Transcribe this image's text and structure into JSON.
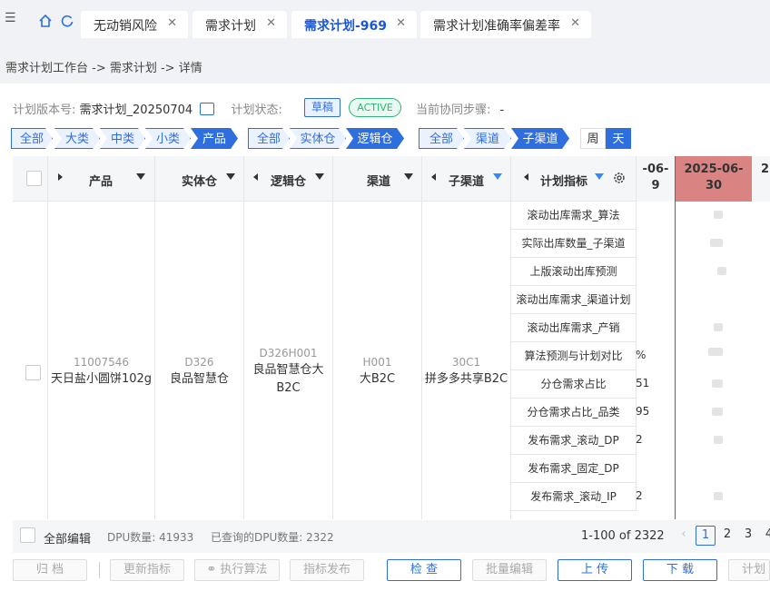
{
  "tabs": [
    {
      "label": "无动销风险"
    },
    {
      "label": "需求计划"
    },
    {
      "label": "需求计划-969"
    },
    {
      "label": "需求计划准确率偏差率"
    }
  ],
  "breadcrumb": "需求计划工作台 -> 需求计划 -> 详情",
  "plan_info": {
    "version_label": "计划版本号:",
    "version_value": "需求计划_20250704",
    "status_label": "计划状态:",
    "status_draft": "草稿",
    "status_active": "ACTIVE",
    "step_label": "当前协同步骤:",
    "step_value": "-"
  },
  "product_levels": [
    "全部",
    "大类",
    "中类",
    "小类",
    "产品"
  ],
  "warehouse_levels": [
    "全部",
    "实体仓",
    "逻辑仓"
  ],
  "channel_levels": [
    "全部",
    "渠道",
    "子渠道"
  ],
  "time_grain": [
    "周",
    "天"
  ],
  "columns": {
    "product": "产品",
    "physical_wh": "实体仓",
    "logical_wh": "逻辑仓",
    "channel": "渠道",
    "sub_channel": "子渠道",
    "metric": "计划指标"
  },
  "dates": {
    "prev_partial_top": "-06-",
    "prev_partial_bottom": "9",
    "current_top": "2025-06-",
    "current_bottom": "30",
    "next_partial": "2"
  },
  "row": {
    "product_code": "11007546",
    "product_name": "天日盐小圆饼102g",
    "physical_code": "D326",
    "physical_name": "良品智慧仓",
    "logical_code": "D326H001",
    "logical_name_1": "良品智慧仓大",
    "logical_name_2": "B2C",
    "channel_code": "H001",
    "channel_name": "大B2C",
    "sub_code": "30C1",
    "sub_name": "拼多多共享B2C"
  },
  "metrics": [
    "滚动出库需求_算法",
    "实际出库数量_子渠道",
    "上版滚动出库预测",
    "滚动出库需求_渠道计划",
    "滚动出库需求_产销",
    "算法预测与计划对比",
    "分仓需求占比",
    "分仓需求占比_品类",
    "发布需求_滚动_DP",
    "发布需求_固定_DP",
    "发布需求_滚动_IP"
  ],
  "truncated_values": [
    "%",
    "51",
    "95",
    "2",
    "2"
  ],
  "footer": {
    "edit_all": "全部编辑",
    "dpu_count": "DPU数量: 41933",
    "queried": "已查询的DPU数量: 2322",
    "range": "1-100 of 2322",
    "pages": [
      "1",
      "2",
      "3",
      "4"
    ]
  },
  "actions": [
    "归 档",
    "更新指标",
    "执行算法",
    "指标发布",
    "检 查",
    "批量编辑",
    "上 传",
    "下 载",
    "计划"
  ],
  "colors": {
    "accent": "#2f6fdd",
    "today_header": "#d98383",
    "active_green": "#2bb673"
  }
}
